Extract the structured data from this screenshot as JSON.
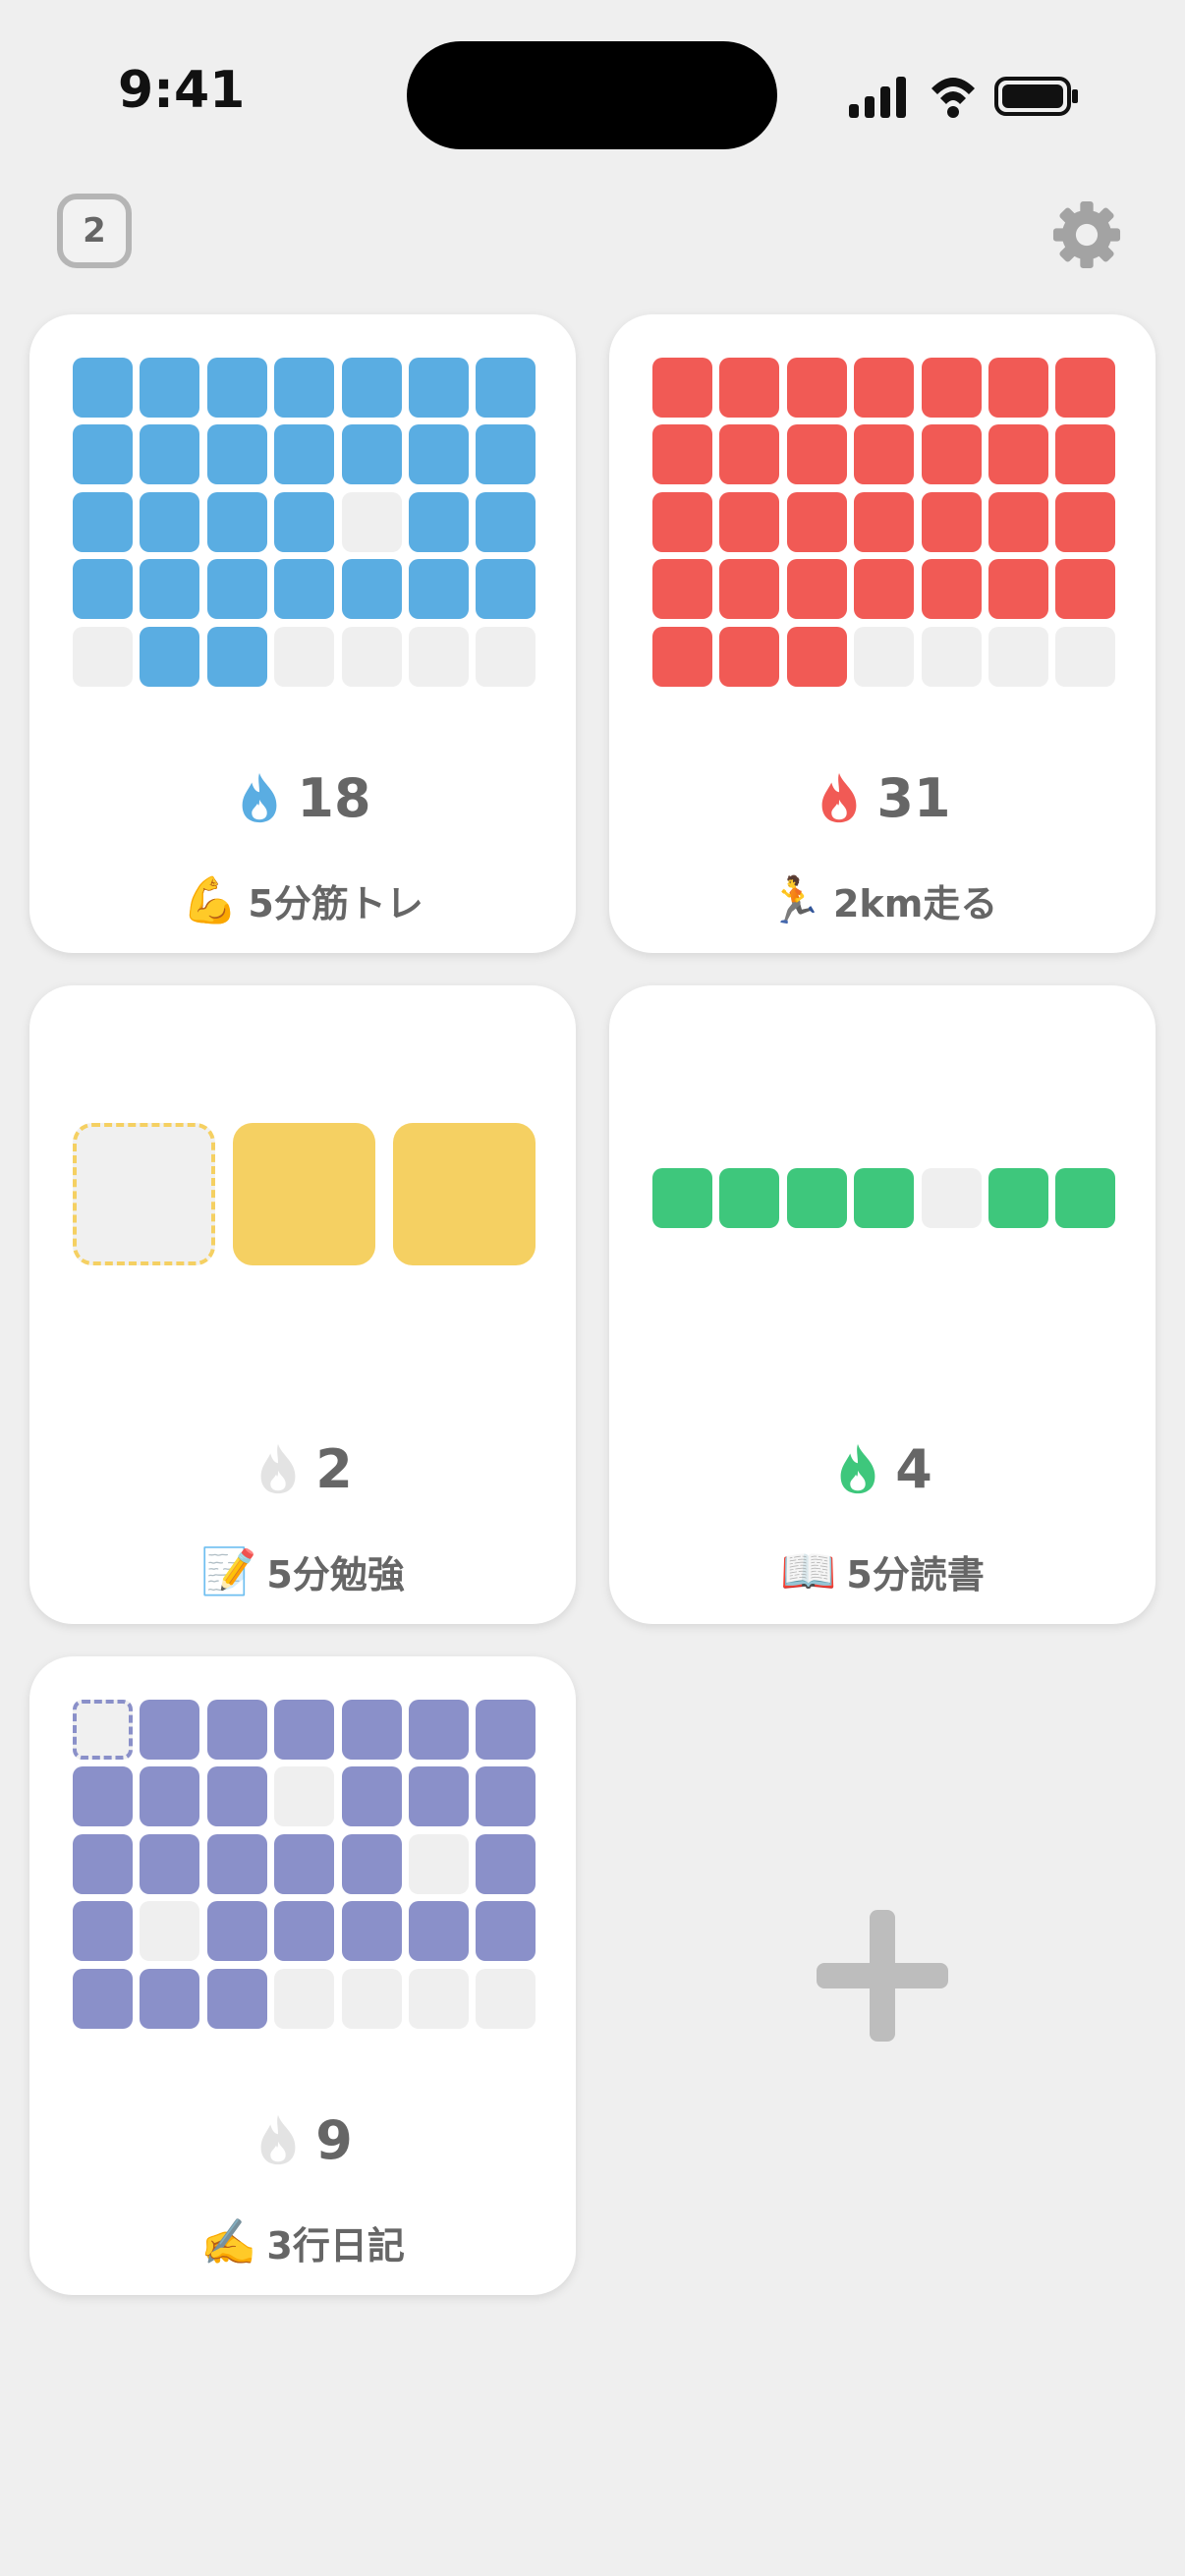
{
  "status_bar": {
    "time": "9:41"
  },
  "header": {
    "badge_count": "2"
  },
  "colors": {
    "blue": "#5aade2",
    "red": "#f15a55",
    "yellow": "#f5d062",
    "green": "#3ec77c",
    "purple": "#8a90c9",
    "empty": "#efefef",
    "flame_inactive": "#e3e3e3",
    "add": "#bdbdbd"
  },
  "habits": [
    {
      "id": "strength",
      "emoji": "💪",
      "name": "5分筋トレ",
      "streak": "18",
      "color": "blue",
      "flame_active": true,
      "grid": {
        "cols": 7,
        "filled": [
          1,
          1,
          1,
          1,
          1,
          1,
          1,
          1,
          1,
          1,
          1,
          1,
          1,
          1,
          1,
          1,
          1,
          1,
          0,
          1,
          1,
          1,
          1,
          1,
          1,
          1,
          1,
          1,
          0,
          1,
          1,
          0,
          0,
          0,
          0
        ]
      }
    },
    {
      "id": "run",
      "emoji": "🏃",
      "name": "2km走る",
      "streak": "31",
      "color": "red",
      "flame_active": true,
      "grid": {
        "cols": 7,
        "filled": [
          1,
          1,
          1,
          1,
          1,
          1,
          1,
          1,
          1,
          1,
          1,
          1,
          1,
          1,
          1,
          1,
          1,
          1,
          1,
          1,
          1,
          1,
          1,
          1,
          1,
          1,
          1,
          1,
          1,
          1,
          1,
          0,
          0,
          0,
          0
        ]
      }
    },
    {
      "id": "study",
      "emoji": "📝",
      "name": "5分勉強",
      "streak": "2",
      "color": "yellow",
      "flame_active": false,
      "grid": {
        "cols": 3,
        "filled": [
          2,
          1,
          1
        ]
      }
    },
    {
      "id": "reading",
      "emoji": "📖",
      "name": "5分読書",
      "streak": "4",
      "color": "green",
      "flame_active": true,
      "grid": {
        "cols": 7,
        "filled": [
          1,
          1,
          1,
          1,
          0,
          1,
          1
        ]
      }
    },
    {
      "id": "diary",
      "emoji": "✍️",
      "name": "3行日記",
      "streak": "9",
      "color": "purple",
      "flame_active": false,
      "grid": {
        "cols": 7,
        "filled": [
          2,
          1,
          1,
          1,
          1,
          1,
          1,
          1,
          1,
          1,
          0,
          1,
          1,
          1,
          1,
          1,
          1,
          1,
          1,
          0,
          1,
          1,
          0,
          1,
          1,
          1,
          1,
          1,
          1,
          1,
          1,
          0,
          0,
          0,
          0
        ]
      }
    }
  ]
}
